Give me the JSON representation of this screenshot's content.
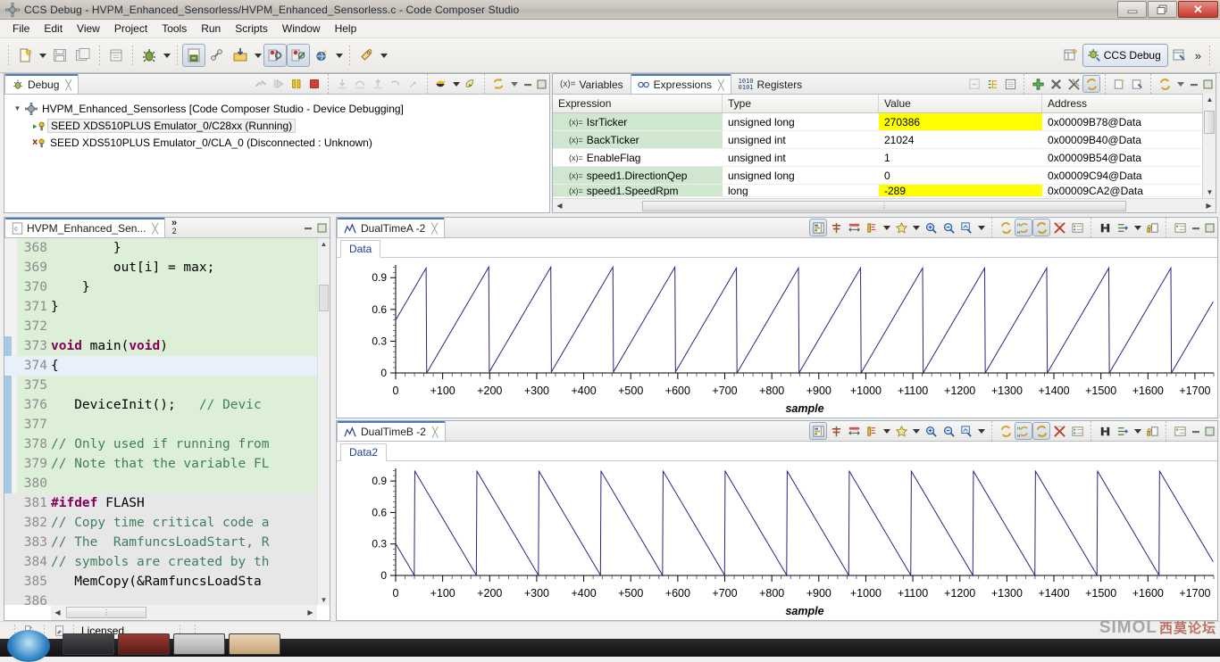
{
  "window": {
    "title": "CCS Debug - HVPM_Enhanced_Sensorless/HVPM_Enhanced_Sensorless.c - Code Composer Studio",
    "minimize_label": "–",
    "restore_label": "❐",
    "close_label": "✕"
  },
  "menu": {
    "items": [
      "File",
      "Edit",
      "View",
      "Project",
      "Tools",
      "Run",
      "Scripts",
      "Window",
      "Help"
    ]
  },
  "toolbar": {
    "icons": [
      "new-file-icon",
      "save-icon",
      "save-all-icon",
      "open-resource-icon",
      "debug-icon",
      "build-icon",
      "link-icon",
      "import-icon",
      "breakpoint-toggle-icon",
      "breakpoint-skip-icon",
      "globe-icon",
      "run-icon"
    ],
    "perspective": {
      "open_perspective_icon": "open-perspective-icon",
      "active_label": "CCS Debug",
      "active_icon": "ccs-debug-perspective-icon",
      "other_perspective_icon": "edit-perspective-icon",
      "overflow_label": "»"
    }
  },
  "debug_view": {
    "tab_label": "Debug",
    "tab_icon": "debug-view-icon",
    "toolbar_icons": [
      "disconnect-icon",
      "step-over-disabled-icon",
      "suspend-icon",
      "terminate-icon",
      "step-into-icon",
      "step-return-icon",
      "step-over-icon",
      "step-back-icon",
      "restart-icon",
      "connect-target-icon",
      "launch-icon",
      "refresh-icon"
    ],
    "tree": [
      {
        "label": "HVPM_Enhanced_Sensorless [Code Composer Studio - Device Debugging]",
        "icon": "launch-config-icon",
        "expanded": true,
        "selected": false,
        "indent": 0
      },
      {
        "label": "SEED XDS510PLUS Emulator_0/C28xx (Running)",
        "icon": "core-running-icon",
        "expanded": false,
        "selected": true,
        "indent": 1
      },
      {
        "label": "SEED XDS510PLUS Emulator_0/CLA_0 (Disconnected : Unknown)",
        "icon": "core-disconnected-icon",
        "expanded": false,
        "selected": false,
        "indent": 1
      }
    ]
  },
  "expressions_view": {
    "tabs": [
      {
        "label": "Variables",
        "icon": "variables-icon",
        "active": false
      },
      {
        "label": "Expressions",
        "icon": "expressions-icon",
        "active": true
      },
      {
        "label": "Registers",
        "icon": "registers-icon",
        "active": false
      }
    ],
    "toolbar_icons": [
      "collapse-all-icon",
      "expand-all-icon",
      "collapse-icon",
      "add-expression-icon",
      "remove-expression-icon",
      "remove-all-icon",
      "refresh-expressions-icon",
      "new-view-icon",
      "copy-view-icon",
      "link-debug-icon",
      "view-menu-icon",
      "minimize-icon",
      "maximize-icon"
    ],
    "columns": [
      "Expression",
      "Type",
      "Value",
      "Address"
    ],
    "rows": [
      {
        "expression": "IsrTicker",
        "type": "unsigned long",
        "value": "270386",
        "address": "0x00009B78@Data",
        "highlight": true,
        "name_shaded": true
      },
      {
        "expression": "BackTicker",
        "type": "unsigned int",
        "value": "21024",
        "address": "0x00009B40@Data",
        "highlight": false,
        "name_shaded": true
      },
      {
        "expression": "EnableFlag",
        "type": "unsigned int",
        "value": "1",
        "address": "0x00009B54@Data",
        "highlight": false,
        "name_shaded": false
      },
      {
        "expression": "speed1.DirectionQep",
        "type": "unsigned long",
        "value": "0",
        "address": "0x00009C94@Data",
        "highlight": false,
        "name_shaded": true
      },
      {
        "expression": "speed1.SpeedRpm",
        "type": "long",
        "value": "-289",
        "address": "0x00009CA2@Data",
        "highlight": true,
        "name_shaded": true
      }
    ]
  },
  "editor": {
    "tab_label": "HVPM_Enhanced_Sen...",
    "tab_icon": "c-file-icon",
    "overflow_label": "»",
    "overflow_count": "2",
    "lines": [
      {
        "num": "368",
        "segments": [
          {
            "t": "        }",
            "c": "plain"
          }
        ],
        "bg": "green",
        "changed": false
      },
      {
        "num": "369",
        "segments": [
          {
            "t": "        out[i] = max;",
            "c": "plain"
          }
        ],
        "bg": "green",
        "changed": false
      },
      {
        "num": "370",
        "segments": [
          {
            "t": "    }",
            "c": "plain"
          }
        ],
        "bg": "green",
        "changed": false
      },
      {
        "num": "371",
        "segments": [
          {
            "t": "}",
            "c": "plain"
          }
        ],
        "bg": "green",
        "changed": false
      },
      {
        "num": "372",
        "segments": [
          {
            "t": "",
            "c": "plain"
          }
        ],
        "bg": "green",
        "changed": false
      },
      {
        "num": "373",
        "segments": [
          {
            "t": "void",
            "c": "kw"
          },
          {
            "t": " main(",
            "c": "plain"
          },
          {
            "t": "void",
            "c": "kw"
          },
          {
            "t": ")",
            "c": "plain"
          }
        ],
        "bg": "green",
        "changed": true
      },
      {
        "num": "374",
        "segments": [
          {
            "t": "{",
            "c": "plain"
          }
        ],
        "bg": "highlight",
        "changed": true
      },
      {
        "num": "375",
        "segments": [
          {
            "t": "",
            "c": "plain"
          }
        ],
        "bg": "green",
        "changed": true
      },
      {
        "num": "376",
        "segments": [
          {
            "t": "   DeviceInit();   ",
            "c": "plain"
          },
          {
            "t": "// Devic",
            "c": "cm"
          }
        ],
        "bg": "green",
        "changed": true
      },
      {
        "num": "377",
        "segments": [
          {
            "t": "",
            "c": "plain"
          }
        ],
        "bg": "green",
        "changed": true
      },
      {
        "num": "378",
        "segments": [
          {
            "t": "// Only used if running from",
            "c": "cm"
          }
        ],
        "bg": "green",
        "changed": true
      },
      {
        "num": "379",
        "segments": [
          {
            "t": "// Note that the variable FL",
            "c": "cm"
          }
        ],
        "bg": "green",
        "changed": true
      },
      {
        "num": "380",
        "segments": [
          {
            "t": "",
            "c": "plain"
          }
        ],
        "bg": "green",
        "changed": true
      },
      {
        "num": "381",
        "segments": [
          {
            "t": "#ifdef",
            "c": "pp"
          },
          {
            "t": " FLASH",
            "c": "plain"
          }
        ],
        "bg": "gray",
        "changed": true
      },
      {
        "num": "382",
        "segments": [
          {
            "t": "// Copy time critical code a",
            "c": "cm"
          }
        ],
        "bg": "gray",
        "changed": true
      },
      {
        "num": "383",
        "segments": [
          {
            "t": "// The  RamfuncsLoadStart, R",
            "c": "cm"
          }
        ],
        "bg": "gray",
        "changed": true
      },
      {
        "num": "384",
        "segments": [
          {
            "t": "// symbols are created by th",
            "c": "cm"
          }
        ],
        "bg": "gray",
        "changed": true
      },
      {
        "num": "385",
        "segments": [
          {
            "t": "   MemCopy(&RamfuncsLoadSta",
            "c": "plain"
          }
        ],
        "bg": "gray",
        "changed": true
      },
      {
        "num": "386",
        "segments": [
          {
            "t": "",
            "c": "plain"
          }
        ],
        "bg": "gray",
        "changed": true
      }
    ]
  },
  "graphs": [
    {
      "tab_label": "DualTimeA -2",
      "tab_icon": "graph-icon",
      "data_tab_label": "Data",
      "toolbar_icons": [
        "graph-properties-icon",
        "align-icon",
        "measurement-icon",
        "marker-icon",
        "add-marker-icon",
        "zoom-in-icon",
        "zoom-out-icon",
        "zoom-fit-icon",
        "refresh-graph-icon",
        "continuous-refresh-h-icon",
        "continuous-refresh-icon",
        "delete-graph-icon",
        "legend-icon",
        "search-icon",
        "export-icon",
        "lock-icon",
        "settings-icon",
        "minimize-icon",
        "maximize-icon"
      ]
    },
    {
      "tab_label": "DualTimeB -2",
      "tab_icon": "graph-icon",
      "data_tab_label": "Data2",
      "toolbar_icons": [
        "graph-properties-icon",
        "align-icon",
        "measurement-icon",
        "marker-icon",
        "add-marker-icon",
        "zoom-in-icon",
        "zoom-out-icon",
        "zoom-fit-icon",
        "refresh-graph-icon",
        "continuous-refresh-h-icon",
        "continuous-refresh-icon",
        "delete-graph-icon",
        "legend-icon",
        "search-icon",
        "export-icon",
        "lock-icon",
        "settings-icon",
        "minimize-icon",
        "maximize-icon"
      ]
    }
  ],
  "chart_data": [
    {
      "type": "line",
      "title": "DualTimeA -2",
      "xlabel": "sample",
      "ylabel": "",
      "xlim": [
        0,
        1740
      ],
      "ylim": [
        0,
        1.02
      ],
      "yticks": [
        "0",
        "0.3",
        "0.6",
        "0.9"
      ],
      "ytick_values": [
        0,
        0.3,
        0.6,
        0.9
      ],
      "xticks": [
        "0",
        "+100",
        "+200",
        "+300",
        "+400",
        "+500",
        "+600",
        "+700",
        "+800",
        "+900",
        "+1000",
        "+1100",
        "+1200",
        "+1300",
        "+1400",
        "+1500",
        "+1600",
        "+1700"
      ],
      "xtick_values": [
        0,
        100,
        200,
        300,
        400,
        500,
        600,
        700,
        800,
        900,
        1000,
        1100,
        1200,
        1300,
        1400,
        1500,
        1600,
        1700
      ],
      "grid": false,
      "series_color": "#26267f",
      "waveform": "sawtooth-rising",
      "period_samples": 132,
      "phase_offset_samples": 66,
      "amplitude_min": 0,
      "amplitude_max": 1.0,
      "legend": []
    },
    {
      "type": "line",
      "title": "DualTimeB -2",
      "xlabel": "sample",
      "ylabel": "",
      "xlim": [
        0,
        1740
      ],
      "ylim": [
        0,
        1.02
      ],
      "yticks": [
        "0",
        "0.3",
        "0.6",
        "0.9"
      ],
      "ytick_values": [
        0,
        0.3,
        0.6,
        0.9
      ],
      "xticks": [
        "0",
        "+100",
        "+200",
        "+300",
        "+400",
        "+500",
        "+600",
        "+700",
        "+800",
        "+900",
        "+1000",
        "+1100",
        "+1200",
        "+1300",
        "+1400",
        "+1500",
        "+1600",
        "+1700"
      ],
      "xtick_values": [
        0,
        100,
        200,
        300,
        400,
        500,
        600,
        700,
        800,
        900,
        1000,
        1100,
        1200,
        1300,
        1400,
        1500,
        1600,
        1700
      ],
      "grid": false,
      "series_color": "#26267f",
      "waveform": "sawtooth-falling",
      "period_samples": 132,
      "phase_offset_samples": 92,
      "amplitude_min": 0,
      "amplitude_max": 1.0,
      "legend": []
    }
  ],
  "status_bar": {
    "icons": [
      "new-item-icon",
      "writable-icon"
    ],
    "text": "Licensed"
  },
  "watermark": {
    "text": "SIMOL",
    "text_cn": "西莫论坛"
  },
  "colors": {
    "accent": "#4f7ab5",
    "highlight_yellow": "#ffff00",
    "name_shade_green": "#cfe7cf",
    "code_bg": "#ddefd7",
    "plot_line": "#26267f",
    "close_red": "#c6392c"
  }
}
